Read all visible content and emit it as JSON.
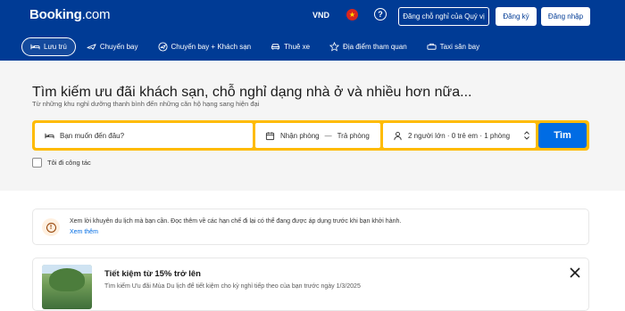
{
  "header": {
    "logo_main": "Booking",
    "logo_suffix": ".com",
    "currency": "VND",
    "flag_icon": "vietnam-flag-icon",
    "help_icon": "question-circle-icon",
    "list_property_label": "Đăng chỗ nghỉ của Quý vị",
    "register_label": "Đăng ký",
    "signin_label": "Đăng nhập",
    "background_color": "#003b95"
  },
  "nav": {
    "items": [
      {
        "label": "Lưu trú",
        "icon": "bed-icon",
        "active": true
      },
      {
        "label": "Chuyến bay",
        "icon": "plane-icon",
        "active": false
      },
      {
        "label": "Chuyến bay + Khách sạn",
        "icon": "plane-hotel-icon",
        "active": false
      },
      {
        "label": "Thuê xe",
        "icon": "car-icon",
        "active": false
      },
      {
        "label": "Địa điểm tham quan",
        "icon": "attractions-icon",
        "active": false
      },
      {
        "label": "Taxi sân bay",
        "icon": "taxi-icon",
        "active": false
      }
    ]
  },
  "hero": {
    "title": "Tìm kiếm ưu đãi khách sạn, chỗ nghỉ dạng nhà ở và nhiều hơn nữa...",
    "subtitle": "Từ những khu nghỉ dưỡng thanh bình đến những căn hộ hạng sang hiện đại"
  },
  "search": {
    "destination_placeholder": "Bạn muốn đến đâu?",
    "checkin_label": "Nhận phòng",
    "date_separator": "—",
    "checkout_label": "Trả phòng",
    "guests_summary": "2 người lớn · 0 trẻ em · 1 phòng",
    "search_button": "Tìm",
    "accent_color": "#febb02",
    "button_color": "#006ce4"
  },
  "business_trip": {
    "label": "Tôi đi công tác",
    "checked": false
  },
  "notice": {
    "text": "Xem lời khuyên du lịch mà bạn cần. Đọc thêm về các hạn chế đi lại có thể đang được áp dụng trước khi bạn khởi hành.",
    "link": "Xem thêm"
  },
  "promo": {
    "title": "Tiết kiệm từ 15% trở lên",
    "text": "Tìm kiếm Ưu đãi Mùa Du lịch để tiết kiệm cho kỳ nghỉ tiếp theo của bạn trước ngày 1/3/2025"
  }
}
